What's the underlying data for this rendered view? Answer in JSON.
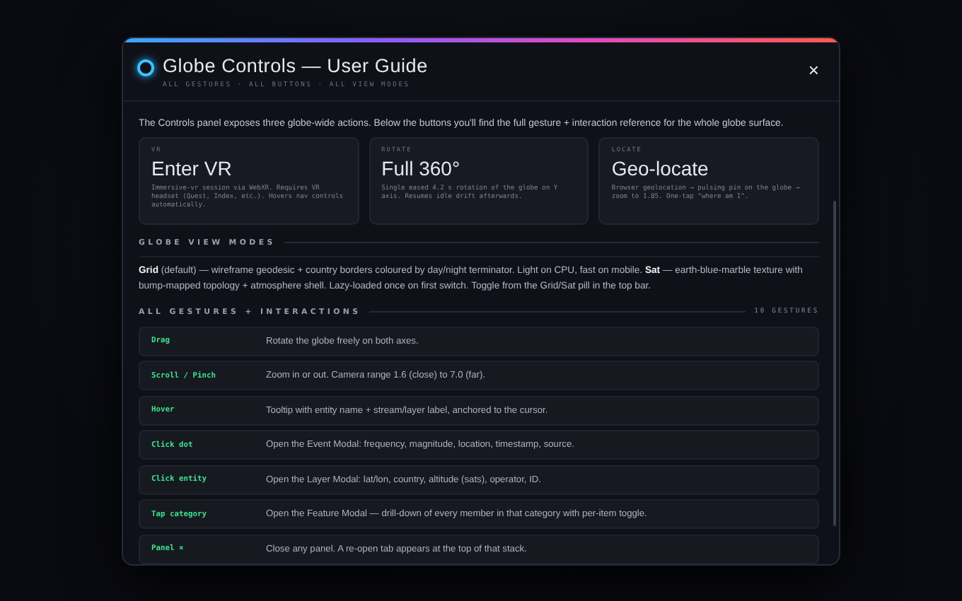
{
  "modal": {
    "title": "Globe Controls — User Guide",
    "subtitle": "ALL GESTURES · ALL BUTTONS · ALL VIEW MODES",
    "close": "×",
    "intro": "The Controls panel exposes three globe-wide actions. Below the buttons you'll find the full gesture + interaction reference for the whole globe surface.",
    "actions": [
      {
        "tag": "VR",
        "title": "Enter VR",
        "text": "Immersive-vr session via WebXR. Requires VR headset (Quest, Index, etc.). Hovers nav controls automatically."
      },
      {
        "tag": "ROTATE",
        "title": "Full 360°",
        "text": "Single eased 4.2 s rotation of the globe on Y axis. Resumes idle drift afterwards."
      },
      {
        "tag": "LOCATE",
        "title": "Geo-locate",
        "text": "Browser geolocation → pulsing pin on the globe → zoom to 1.85. One-tap \"where am I\"."
      }
    ],
    "view_modes": {
      "heading": "GLOBE VIEW MODES",
      "text": "**Grid** (default) — wireframe geodesic + country borders coloured by day/night terminator. Light on CPU, fast on mobile. **Sat** — earth-blue-marble texture with bump-mapped topology + atmosphere shell. Lazy-loaded once on first switch. Toggle from the Grid/Sat pill in the top bar."
    },
    "gestures": {
      "heading": "ALL GESTURES + INTERACTIONS",
      "count": "10 GESTURES",
      "rows": [
        {
          "gesture": "Drag",
          "action": "Rotate the globe freely on both axes."
        },
        {
          "gesture": "Scroll / Pinch",
          "action": "Zoom in or out. Camera range 1.6 (close) to 7.0 (far)."
        },
        {
          "gesture": "Hover",
          "action": "Tooltip with entity name + stream/layer label, anchored to the cursor."
        },
        {
          "gesture": "Click dot",
          "action": "Open the Event Modal: frequency, magnitude, location, timestamp, source."
        },
        {
          "gesture": "Click entity",
          "action": "Open the Layer Modal: lat/lon, country, altitude (sats), operator, ID."
        },
        {
          "gesture": "Tap category",
          "action": "Open the Feature Modal — drill-down of every member in that category with per-item toggle."
        },
        {
          "gesture": "Panel ×",
          "action": "Close any panel. A re-open tab appears at the top of that stack."
        }
      ]
    }
  }
}
